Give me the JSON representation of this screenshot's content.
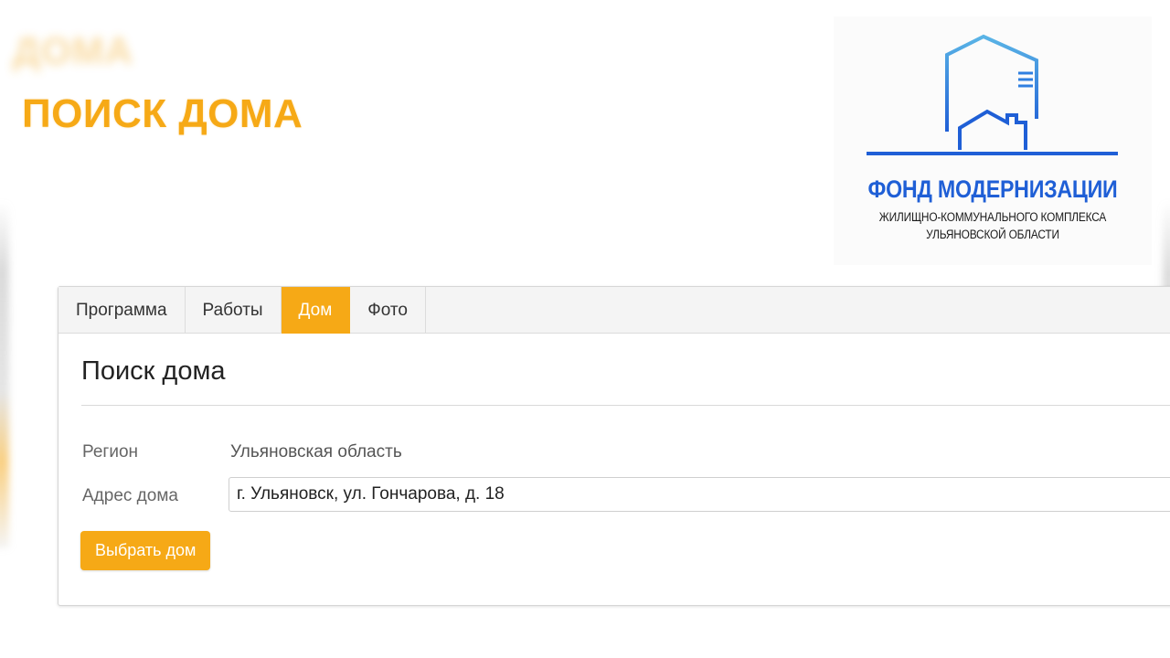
{
  "header": {
    "ghost_title": "ДОМА",
    "title": "ПОИСК ДОМА"
  },
  "logo": {
    "name": "ФОНД МОДЕРНИЗАЦИИ",
    "subtitle_line1": "ЖИЛИЩНО-КОММУНАЛЬНОГО КОМПЛЕКСА",
    "subtitle_line2": "УЛЬЯНОВСКОЙ ОБЛАСТИ",
    "colors": {
      "primary": "#1f5fd6",
      "light": "#5ab4e6"
    }
  },
  "tabs": [
    {
      "label": "Программа",
      "active": false
    },
    {
      "label": "Работы",
      "active": false
    },
    {
      "label": "Дом",
      "active": true
    },
    {
      "label": "Фото",
      "active": false
    }
  ],
  "form": {
    "title": "Поиск дома",
    "region_label": "Регион",
    "region_value": "Ульяновская область",
    "address_label": "Адрес дома",
    "address_value": "г. Ульяновск, ул. Гончарова, д. 18",
    "submit_label": "Выбрать дом"
  },
  "colors": {
    "accent": "#f6a916",
    "tab_bg": "#f4f4f4",
    "text": "#222222"
  }
}
